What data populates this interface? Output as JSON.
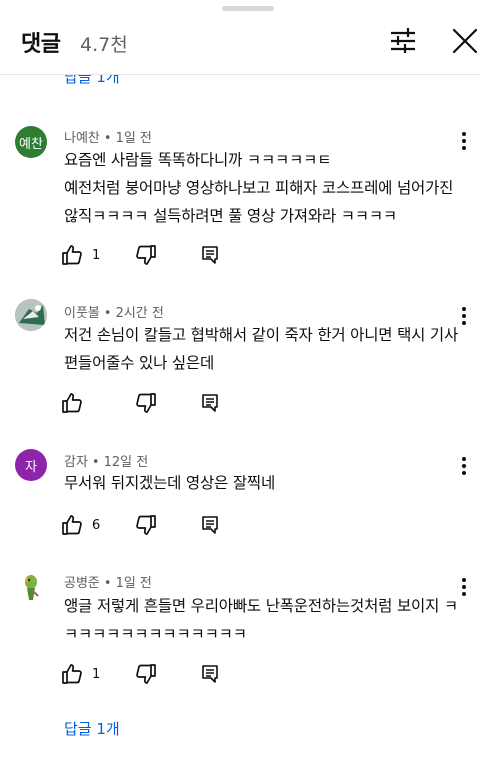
{
  "header": {
    "title": "댓글",
    "count": "4.7천"
  },
  "top_replies_label": "답글 1개",
  "comments": [
    {
      "avatar_text": "예찬",
      "avatar_color": "#2e7d32",
      "author": "나예찬",
      "time": "1일 전",
      "text": "요즘엔 사람들 똑똑하다니까 ㅋㅋㅋㅋㅋㅌ\n예전처럼 붕어마냥 영상하나보고 피해자 코스프레에 넘어가진 않직ㅋㅋㅋㅋ 설득하려면 풀 영상 가져와라 ㅋㅋㅋㅋ",
      "likes": "1"
    },
    {
      "avatar_text": "",
      "avatar_color": "#7a8f86",
      "author": "이풋볼",
      "time": "2시간 전",
      "text": "저건 손님이 칼들고 협박해서 같이 죽자 한거 아니면 택시 기사 편들어줄수 있나 싶은데",
      "likes": ""
    },
    {
      "avatar_text": "자",
      "avatar_color": "#8e24aa",
      "author": "감자",
      "time": "12일 전",
      "text": "무서워 뒤지겠는데 영상은 잘찍네",
      "likes": "6"
    },
    {
      "avatar_text": "",
      "avatar_color": "#ffffff",
      "author": "공병준",
      "time": "1일 전",
      "text": "앵글 저렇게 흔들면 우리아빠도 난폭운전하는것처럼 보이지 ㅋㅋㅋㅋㅋㅋㅋㅋㅋㅋㅋㅋㅋㅋ",
      "likes": "1"
    }
  ],
  "replies_label": "답글 1개",
  "icons": {
    "filter": "tune-icon",
    "close": "close-icon",
    "like": "thumb-up-icon",
    "dislike": "thumb-down-icon",
    "reply": "comment-icon",
    "more": "more-vert-icon"
  }
}
